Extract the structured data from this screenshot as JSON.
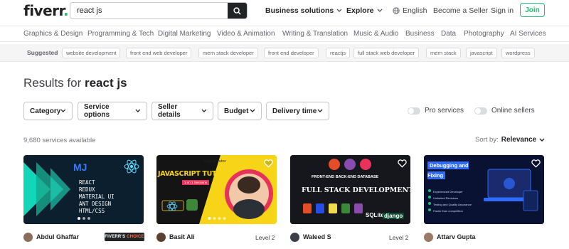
{
  "header": {
    "logo_text": "fiverr",
    "logo_dot": ".",
    "search_value": "react js",
    "nav": {
      "business_solutions": "Business solutions",
      "explore": "Explore",
      "language": "English",
      "become_seller": "Become a Seller",
      "sign_in": "Sign in",
      "join": "Join"
    }
  },
  "categories": [
    "Graphics & Design",
    "Programming & Tech",
    "Digital Marketing",
    "Video & Animation",
    "Writing & Translation",
    "Music & Audio",
    "Business",
    "Data",
    "Photography",
    "AI Services"
  ],
  "suggested": {
    "label": "Suggested",
    "chips": [
      "website development",
      "front end web developer",
      "mern stack developer",
      "front end developer",
      "reactjs",
      "full stack web developer",
      "mern stack",
      "javascript",
      "wordpress"
    ]
  },
  "results": {
    "prefix": "Results for",
    "query": "react js",
    "count": "9,680 services available",
    "sort_label": "Sort by:",
    "sort_value": "Relevance"
  },
  "filters": [
    "Category",
    "Service options",
    "Seller details",
    "Budget",
    "Delivery time"
  ],
  "toggles": [
    "Pro services",
    "Online sellers"
  ],
  "cards": [
    {
      "seller": "Abdul Ghaffar",
      "badge_main": "FIVERR'S",
      "badge_accent": "CHOICE",
      "thumb_lines": [
        "REACT",
        "REDUX",
        "MATERIAL UI",
        "ANT DESIGN",
        "HTML/CSS"
      ],
      "colors": {
        "bg": "#0b1f2e",
        "accent": "#16c7b4"
      }
    },
    {
      "seller": "Basit Ali",
      "level": "Level 2",
      "thumb_title": "JAVASCRIPT TUTOR",
      "thumb_sub": "Coding Tutor",
      "thumb_small": "1 on 1 Sessions",
      "colors": {
        "bg": "#f7d417",
        "accent": "#e8325a"
      }
    },
    {
      "seller": "Waleed S",
      "level": "Level 2",
      "thumb_title": "FULL STACK DEVELOPMENT",
      "thumb_sub": "FRONT-END  BACK-END  DATABASE",
      "thumb_logos": [
        "SQLite",
        "django"
      ],
      "colors": {
        "bg": "#15171c",
        "accent": "#ffffff"
      }
    },
    {
      "seller": "Attarv Gupta",
      "thumb_title": "Debugging and Fixing",
      "thumb_items": [
        "Experienced Developer",
        "Unlimited Revisions",
        "Testing and Quality Assurance",
        "Faster than competition"
      ],
      "colors": {
        "bg": "#0a1233",
        "accent": "#2f6bff"
      }
    }
  ]
}
